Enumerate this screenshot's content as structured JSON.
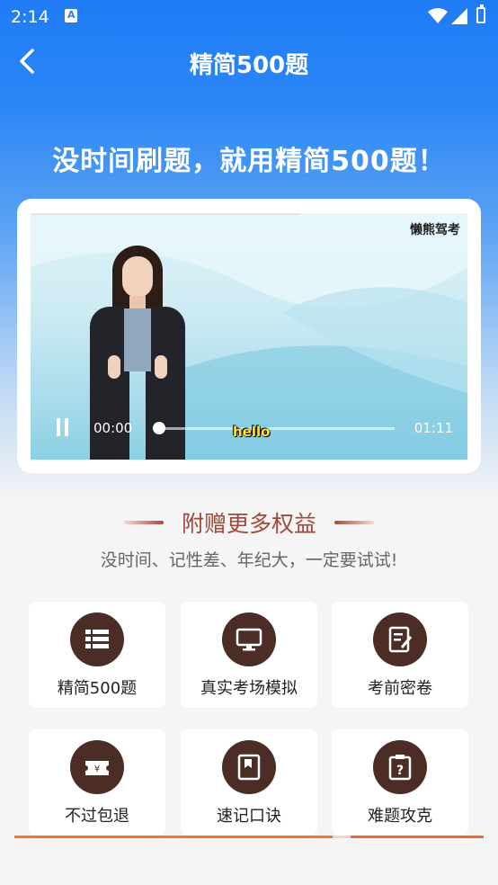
{
  "status_bar": {
    "time": "2:14"
  },
  "nav": {
    "title": "精简500题"
  },
  "hero": {
    "headline": "没时间刷题，就用精简500题！"
  },
  "video": {
    "watermark": "懒熊驾考",
    "current_time": "00:00",
    "total_time": "01:11",
    "subtitle": "hello",
    "progress": 0
  },
  "benefits": {
    "title": "附赠更多权益",
    "subtitle": "没时间、记性差、年纪大，一定要试试!",
    "tiles": [
      {
        "label": "精简500题",
        "icon": "list-icon"
      },
      {
        "label": "真实考场模拟",
        "icon": "monitor-icon"
      },
      {
        "label": "考前密卷",
        "icon": "exam-paper-icon"
      },
      {
        "label": "不过包退",
        "icon": "refund-ticket-icon"
      },
      {
        "label": "速记口诀",
        "icon": "bookmark-book-icon"
      },
      {
        "label": "难题攻克",
        "icon": "question-clipboard-icon"
      }
    ]
  },
  "colors": {
    "brand_blue": "#1f7cf5",
    "icon_bg": "#4b2d26",
    "accent_red": "#a1473a",
    "progress_orange": "#f2772f"
  }
}
